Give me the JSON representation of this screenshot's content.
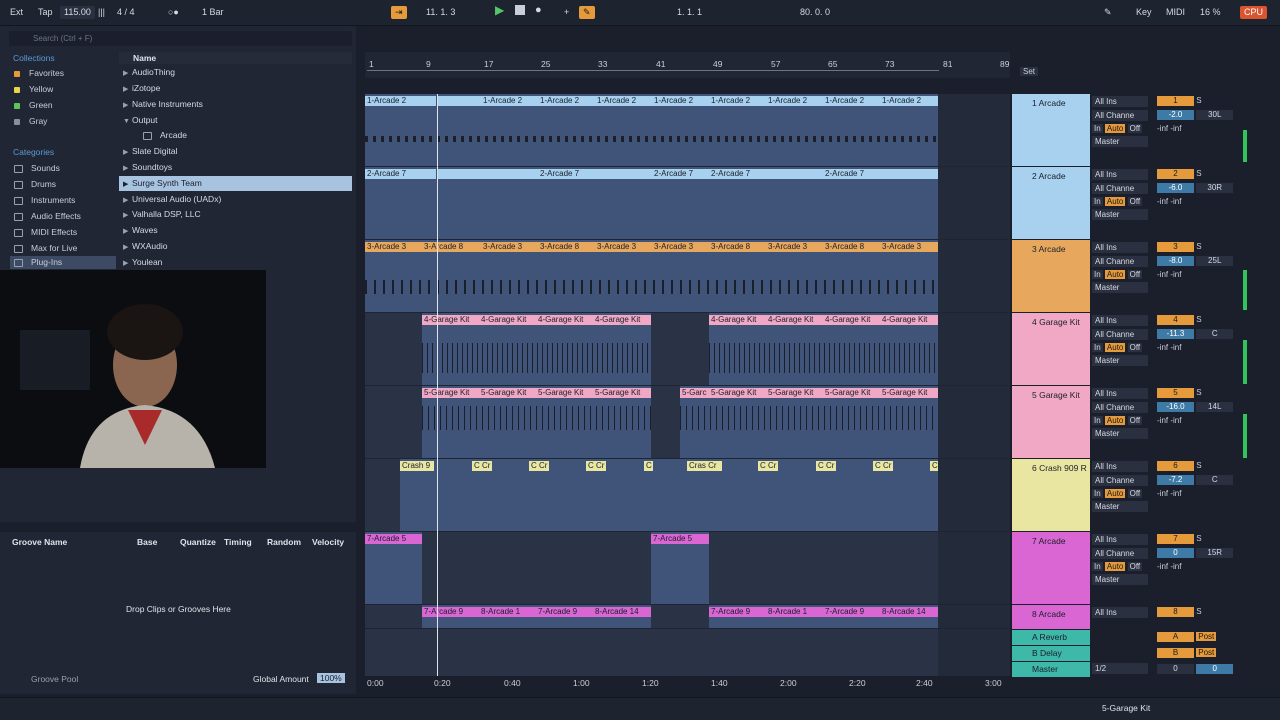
{
  "topbar": {
    "ext": "Ext",
    "tap": "Tap",
    "tempo": "115.00",
    "sig": "4 / 4",
    "quant": "1 Bar",
    "pos": "11. 1. 3",
    "loop_start": "1. 1. 1",
    "loop_len": "80. 0. 0",
    "key": "Key",
    "midi": "MIDI",
    "zoom": "16 %",
    "cpu": "CPU"
  },
  "browser": {
    "search_placeholder": "Search (Ctrl + F)",
    "collections_title": "Collections",
    "collections": [
      {
        "label": "Favorites",
        "color": "#e59a3b"
      },
      {
        "label": "Yellow",
        "color": "#e8d64a"
      },
      {
        "label": "Green",
        "color": "#5bc45b"
      },
      {
        "label": "Gray",
        "color": "#8a8f99"
      }
    ],
    "categories_title": "Categories",
    "categories": [
      "Sounds",
      "Drums",
      "Instruments",
      "Audio Effects",
      "MIDI Effects",
      "Max for Live",
      "Plug-Ins"
    ],
    "list_header": "Name",
    "items": [
      "AudioThing",
      "iZotope",
      "Native Instruments",
      "Output",
      "Arcade",
      "Slate Digital",
      "Soundtoys",
      "Surge Synth Team",
      "Universal Audio (UADx)",
      "Valhalla DSP, LLC",
      "Waves",
      "WXAudio",
      "Youlean"
    ]
  },
  "groove": {
    "name": "Groove Name",
    "base": "Base",
    "quantize": "Quantize",
    "timing": "Timing",
    "random": "Random",
    "velocity": "Velocity",
    "drop": "Drop Clips or Grooves Here",
    "pool": "Groove Pool",
    "global_amount": "Global Amount",
    "global_value": "100%"
  },
  "ruler": [
    "1",
    "9",
    "17",
    "25",
    "33",
    "41",
    "49",
    "57",
    "65",
    "73",
    "81",
    "89"
  ],
  "set_label": "Set",
  "time_ruler": [
    "0:00",
    "0:20",
    "0:40",
    "1:00",
    "1:20",
    "1:40",
    "2:00",
    "2:20",
    "2:40",
    "3:00"
  ],
  "tracks": [
    {
      "name": "1 Arcade",
      "num": "1",
      "vol": "-2.0",
      "pan": "30L",
      "color": "#a8d0ef",
      "clips": [
        "1-Arcade 2",
        "1-Arcade 2",
        "1-Arcade 2",
        "1-Arcade 2",
        "1-Arcade 2",
        "1-Arcade 2",
        "1-Arcade 2",
        "1-Arcade 2",
        "1-Arcade 2"
      ]
    },
    {
      "name": "2 Arcade",
      "num": "2",
      "vol": "-6.0",
      "pan": "30R",
      "color": "#a8d0ef",
      "clips": [
        "2-Arcade 7",
        "2-Arcade 7",
        "2-Arcade 7",
        "2-Arcade 7",
        "2-Arcade 7"
      ]
    },
    {
      "name": "3 Arcade",
      "num": "3",
      "vol": "-8.0",
      "pan": "25L",
      "color": "#e7a85e",
      "clips": [
        "3-Arcade 3",
        "3-Arcade 8",
        "3-Arcade 3",
        "3-Arcade 8",
        "3-Arcade 3",
        "3-Arcade 3",
        "3-Arcade 8",
        "3-Arcade 3",
        "3-Arcade 8",
        "3-Arcade 3"
      ]
    },
    {
      "name": "4 Garage Kit",
      "num": "4",
      "vol": "-11.3",
      "pan": "C",
      "color": "#f0a8c4",
      "clips": [
        "4-Garage Kit",
        "4-Garage Kit",
        "4-Garage Kit",
        "4-Garage Kit",
        "4-Garage Kit",
        "4-Garage Kit",
        "4-Garage Kit",
        "4-Garage Kit"
      ]
    },
    {
      "name": "5 Garage Kit",
      "num": "5",
      "vol": "-16.0",
      "pan": "14L",
      "color": "#f0a8c4",
      "clips": [
        "5-Garage Kit",
        "5-Garage Kit",
        "5-Garage Kit",
        "5-Garage Kit",
        "5-Garc",
        "5-Garage Kit",
        "5-Garage Kit",
        "5-Garage Kit",
        "5-Garage Kit"
      ]
    },
    {
      "name": "6 Crash 909 R",
      "num": "6",
      "vol": "-7.2",
      "pan": "C",
      "color": "#e8e6a0",
      "clips": [
        "Crash 9",
        "C Cr",
        "C Cr",
        "C Cr",
        "C",
        "Cras Cr",
        "C Cr",
        "C Cr",
        "C Cr",
        "C"
      ]
    },
    {
      "name": "7 Arcade",
      "num": "7",
      "vol": "0",
      "pan": "15R",
      "color": "#d966d3",
      "clips": [
        "7-Arcade 5",
        "7-Arcade 5"
      ]
    },
    {
      "name": "8 Arcade",
      "num": "8",
      "color": "#d966d3",
      "clips": [
        "7-Arcade 9",
        "8-Arcade 1",
        "7-Arcade 9",
        "8-Arcade 14",
        "7-Arcade 9",
        "8-Arcade 1",
        "7-Arcade 9",
        "8-Arcade 14"
      ]
    }
  ],
  "returns": [
    {
      "name": "A Reverb",
      "letter": "A",
      "post": "Post",
      "color": "#3eb8a8"
    },
    {
      "name": "B Delay",
      "letter": "B",
      "post": "Post",
      "color": "#3eb8a8"
    }
  ],
  "master": {
    "name": "Master",
    "quant": "1/2",
    "vol": "0",
    "pan": "0"
  },
  "io": {
    "in": "All Ins",
    "channel": "All Channe",
    "out": "Master",
    "in_btn": "In",
    "auto_btn": "Auto",
    "off_btn": "Off",
    "inf": "-inf",
    "solo": "S"
  },
  "status": {
    "track": "5-Garage Kit"
  }
}
